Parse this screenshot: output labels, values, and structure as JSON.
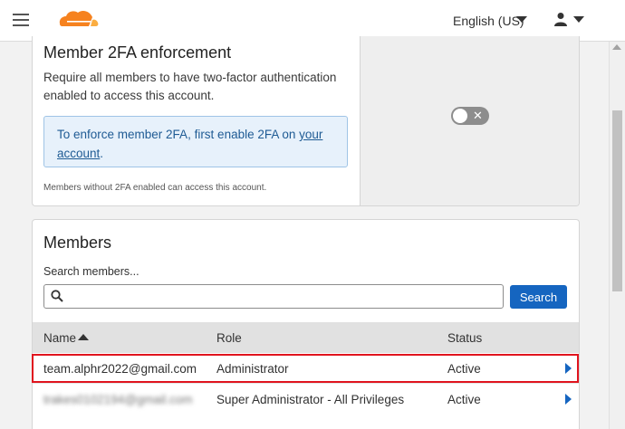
{
  "header": {
    "language_label": "English (US)"
  },
  "twofa": {
    "title": "Member 2FA enforcement",
    "description": "Require all members to have two-factor authentication enabled to access this account.",
    "notice_prefix": "To enforce member 2FA, first enable 2FA on ",
    "notice_link": "your account",
    "notice_suffix": ".",
    "footnote": "Members without 2FA enabled can access this account.",
    "toggle_state": "off",
    "toggle_glyph": "✕"
  },
  "members": {
    "title": "Members",
    "search_label": "Search members...",
    "search_value": "",
    "search_button": "Search",
    "columns": {
      "name": "Name",
      "role": "Role",
      "status": "Status"
    },
    "rows": [
      {
        "name": "team.alphr2022@gmail.com",
        "role": "Administrator",
        "status": "Active"
      },
      {
        "name": "trakes0102194@gmail.com",
        "role": "Super Administrator - All Privileges",
        "status": "Active"
      }
    ]
  },
  "colors": {
    "primary": "#1565c0",
    "brand_orange": "#f6821f",
    "highlight_red": "#e0141e",
    "notice_bg": "#e7f1fb"
  }
}
